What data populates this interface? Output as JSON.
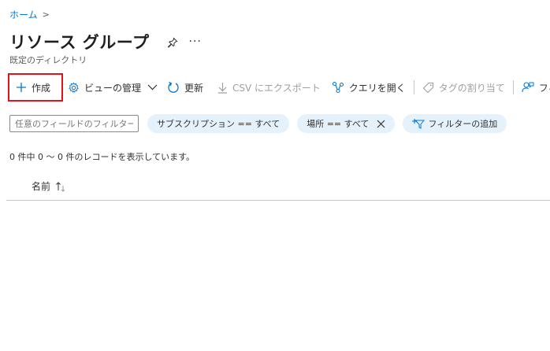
{
  "breadcrumb": {
    "home": "ホーム",
    "separator": ">"
  },
  "header": {
    "title": "リソース グループ",
    "subtitle": "既定のディレクトリ",
    "more_label": "···"
  },
  "toolbar": {
    "create": "作成",
    "manage_view": "ビューの管理",
    "refresh": "更新",
    "export_csv": "CSV にエクスポート",
    "open_query": "クエリを開く",
    "assign_tags": "タグの割り当て",
    "feedback": "フィ"
  },
  "filters": {
    "search_placeholder": "任意のフィールドのフィルター...",
    "subscription_pill": "サブスクリプション == すべて",
    "location_pill": "場所 == すべて",
    "add_filter": "フィルターの追加"
  },
  "records": {
    "summary": "0 件中 0 ～ 0 件のレコードを表示しています。"
  },
  "table": {
    "columns": [
      "名前"
    ]
  },
  "colors": {
    "accent": "#0078d4",
    "highlight_border": "#e3111a",
    "pill_background": "#e5f1fb",
    "disabled_text": "#a19f9d"
  }
}
